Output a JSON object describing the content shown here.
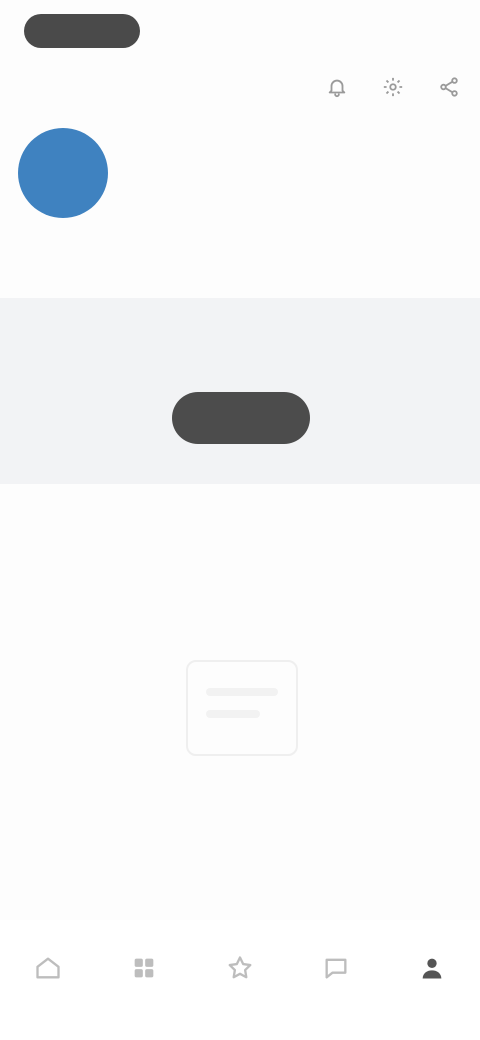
{
  "status_pill": {
    "label": ""
  },
  "header": {
    "actions": [
      {
        "icon": "bell-icon"
      },
      {
        "icon": "gear-icon"
      },
      {
        "icon": "share-icon"
      }
    ]
  },
  "profile": {
    "initials": "",
    "name": "",
    "subtitle": "",
    "action_label": ""
  },
  "section": {
    "title": "",
    "link": ""
  },
  "card": {
    "text": "",
    "button_label": ""
  },
  "section2": {
    "title": ""
  },
  "empty_state": {
    "title": "",
    "subtitle": ""
  },
  "bottom_nav": {
    "items": [
      {
        "icon": "home-icon",
        "label": ""
      },
      {
        "icon": "grid-icon",
        "label": ""
      },
      {
        "icon": "star-icon",
        "label": ""
      },
      {
        "icon": "message-icon",
        "label": ""
      },
      {
        "icon": "profile-icon",
        "label": ""
      }
    ],
    "active_index": 4
  },
  "colors": {
    "avatar": "#3f82c0",
    "primary_button": "#4c4c4c",
    "card_background": "#f2f3f5"
  }
}
